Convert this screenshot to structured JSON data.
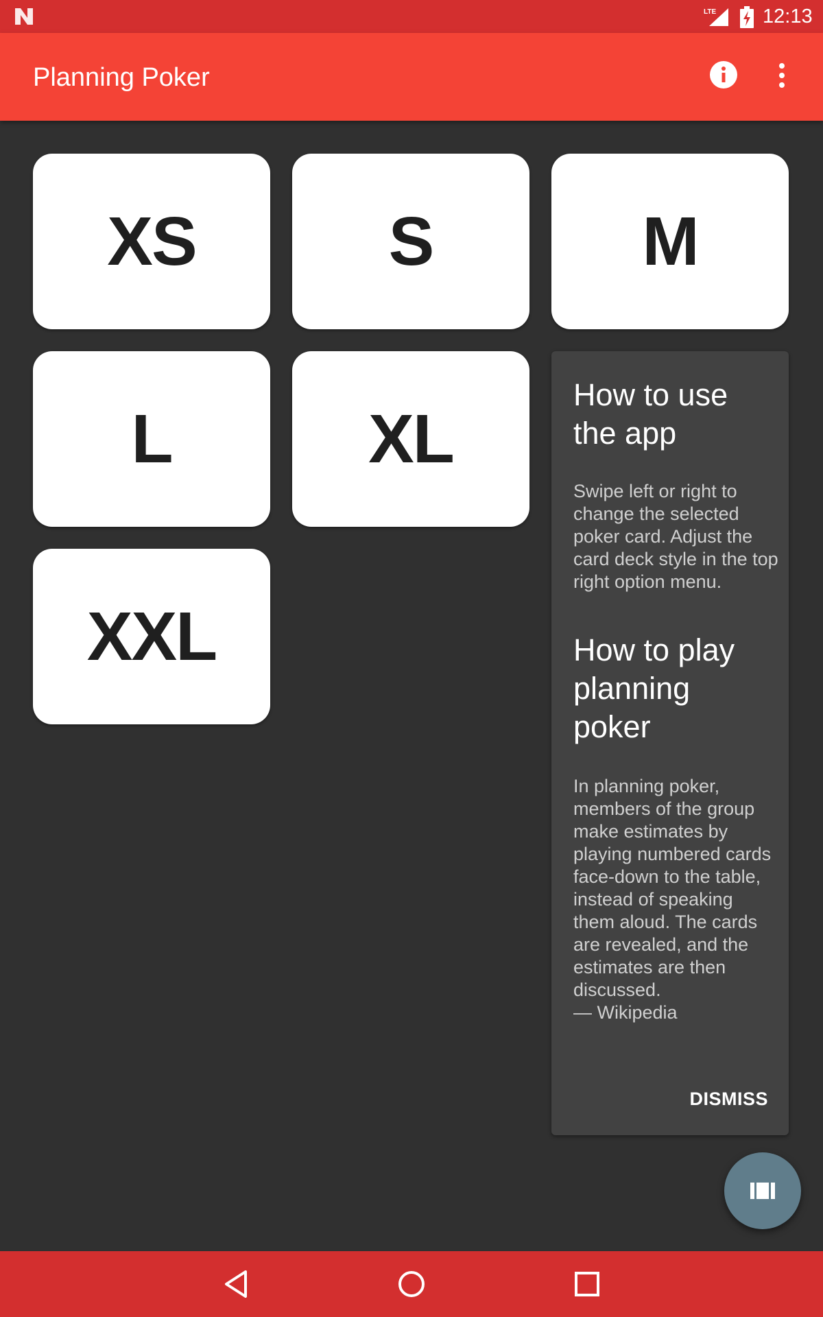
{
  "status_bar": {
    "time": "12:13",
    "network": "LTE"
  },
  "app_bar": {
    "title": "Planning Poker",
    "info_icon": "info-icon",
    "more_icon": "more-vert-icon"
  },
  "cards": [
    "XS",
    "S",
    "M",
    "L",
    "XL",
    "XXL"
  ],
  "help": {
    "usage_title": "How to use the app",
    "usage_body": "Swipe left or right to change the selected poker card. Adjust the card deck style in the top right option menu.",
    "play_title": "How to play planning poker",
    "play_body": "In planning poker, members of the group make estimates by playing numbered cards face-down to the table, instead of speaking them aloud. The cards are revealed, and the estimates are then discussed.",
    "play_source": "— Wikipedia",
    "dismiss_label": "DISMISS"
  },
  "fab": {
    "icon": "card-deck-icon"
  },
  "colors": {
    "status_bar": "#d32f2f",
    "app_bar": "#f44336",
    "background": "#303030",
    "panel": "#424242",
    "fab": "#607d8b",
    "card": "#ffffff"
  }
}
